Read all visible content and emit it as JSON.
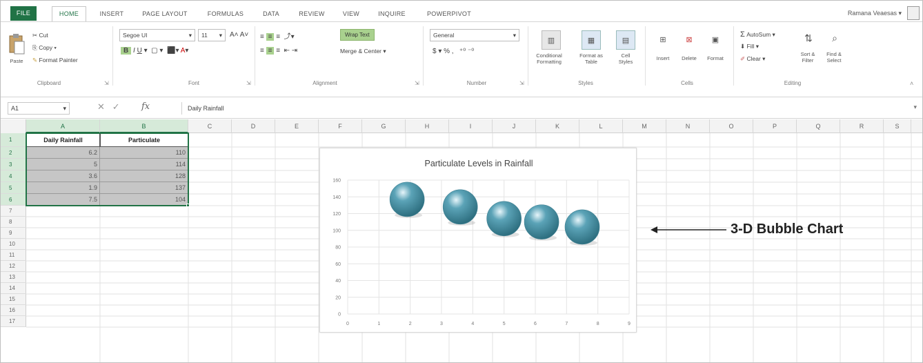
{
  "ribbon_tabs": [
    "FILE",
    "HOME",
    "INSERT",
    "PAGE LAYOUT",
    "FORMULAS",
    "DATA",
    "REVIEW",
    "VIEW",
    "INQUIRE",
    "POWERPIVOT"
  ],
  "active_tab": "HOME",
  "user": "Ramana Veaesas",
  "clipboard": {
    "paste": "Paste",
    "cut": "Cut",
    "copy": "Copy",
    "format_painter": "Format Painter",
    "label": "Clipboard"
  },
  "font": {
    "name": "Segoe UI",
    "size": "11",
    "label": "Font"
  },
  "alignment": {
    "wrap_text": "Wrap Text",
    "merge_center": "Merge & Center",
    "label": "Alignment"
  },
  "number": {
    "format": "General",
    "label": "Number"
  },
  "styles": {
    "conditional": "Conditional\nFormatting",
    "format_as_table": "Format as\nTable",
    "cell_styles": "Cell\nStyles",
    "label": "Styles"
  },
  "cells": {
    "insert": "Insert",
    "delete": "Delete",
    "format": "Format",
    "label": "Cells"
  },
  "editing": {
    "autosum": "AutoSum",
    "fill": "Fill",
    "clear": "Clear",
    "sort_filter": "Sort &\nFilter",
    "find_select": "Find &\nSelect",
    "label": "Editing"
  },
  "formula_bar": {
    "name_box": "A1",
    "fx": "fx",
    "content": "Daily Rainfall"
  },
  "columns": [
    "A",
    "B",
    "C",
    "D",
    "E",
    "F",
    "G",
    "H",
    "I",
    "J",
    "K",
    "L",
    "M",
    "N",
    "O",
    "P",
    "Q",
    "R",
    "S"
  ],
  "rows": [
    "1",
    "2",
    "3",
    "4",
    "5",
    "6",
    "7",
    "8",
    "9",
    "10",
    "11",
    "12",
    "13",
    "14",
    "15",
    "16",
    "17"
  ],
  "sheet": {
    "headers": [
      "Daily Rainfall",
      "Particulate"
    ],
    "data": [
      [
        "6.2",
        "110"
      ],
      [
        "5",
        "114"
      ],
      [
        "3.6",
        "128"
      ],
      [
        "1.9",
        "137"
      ],
      [
        "7.5",
        "104"
      ]
    ]
  },
  "chart_data": {
    "type": "scatter",
    "subtype": "3-D bubble",
    "title": "Particulate Levels in Rainfall",
    "x": [
      1.9,
      3.6,
      5,
      6.2,
      7.5
    ],
    "y": [
      137,
      128,
      114,
      110,
      104
    ],
    "xlim": [
      0,
      9
    ],
    "ylim": [
      0,
      160
    ],
    "x_ticks": [
      "0",
      "1",
      "2",
      "3",
      "4",
      "5",
      "6",
      "7",
      "8",
      "9"
    ],
    "y_ticks": [
      "0",
      "20",
      "40",
      "60",
      "80",
      "100",
      "120",
      "140",
      "160"
    ],
    "grid": true,
    "legend": "none",
    "bubble_color": "#5ba3b7"
  },
  "annotation": "3-D Bubble Chart",
  "accent_color": "#217346"
}
